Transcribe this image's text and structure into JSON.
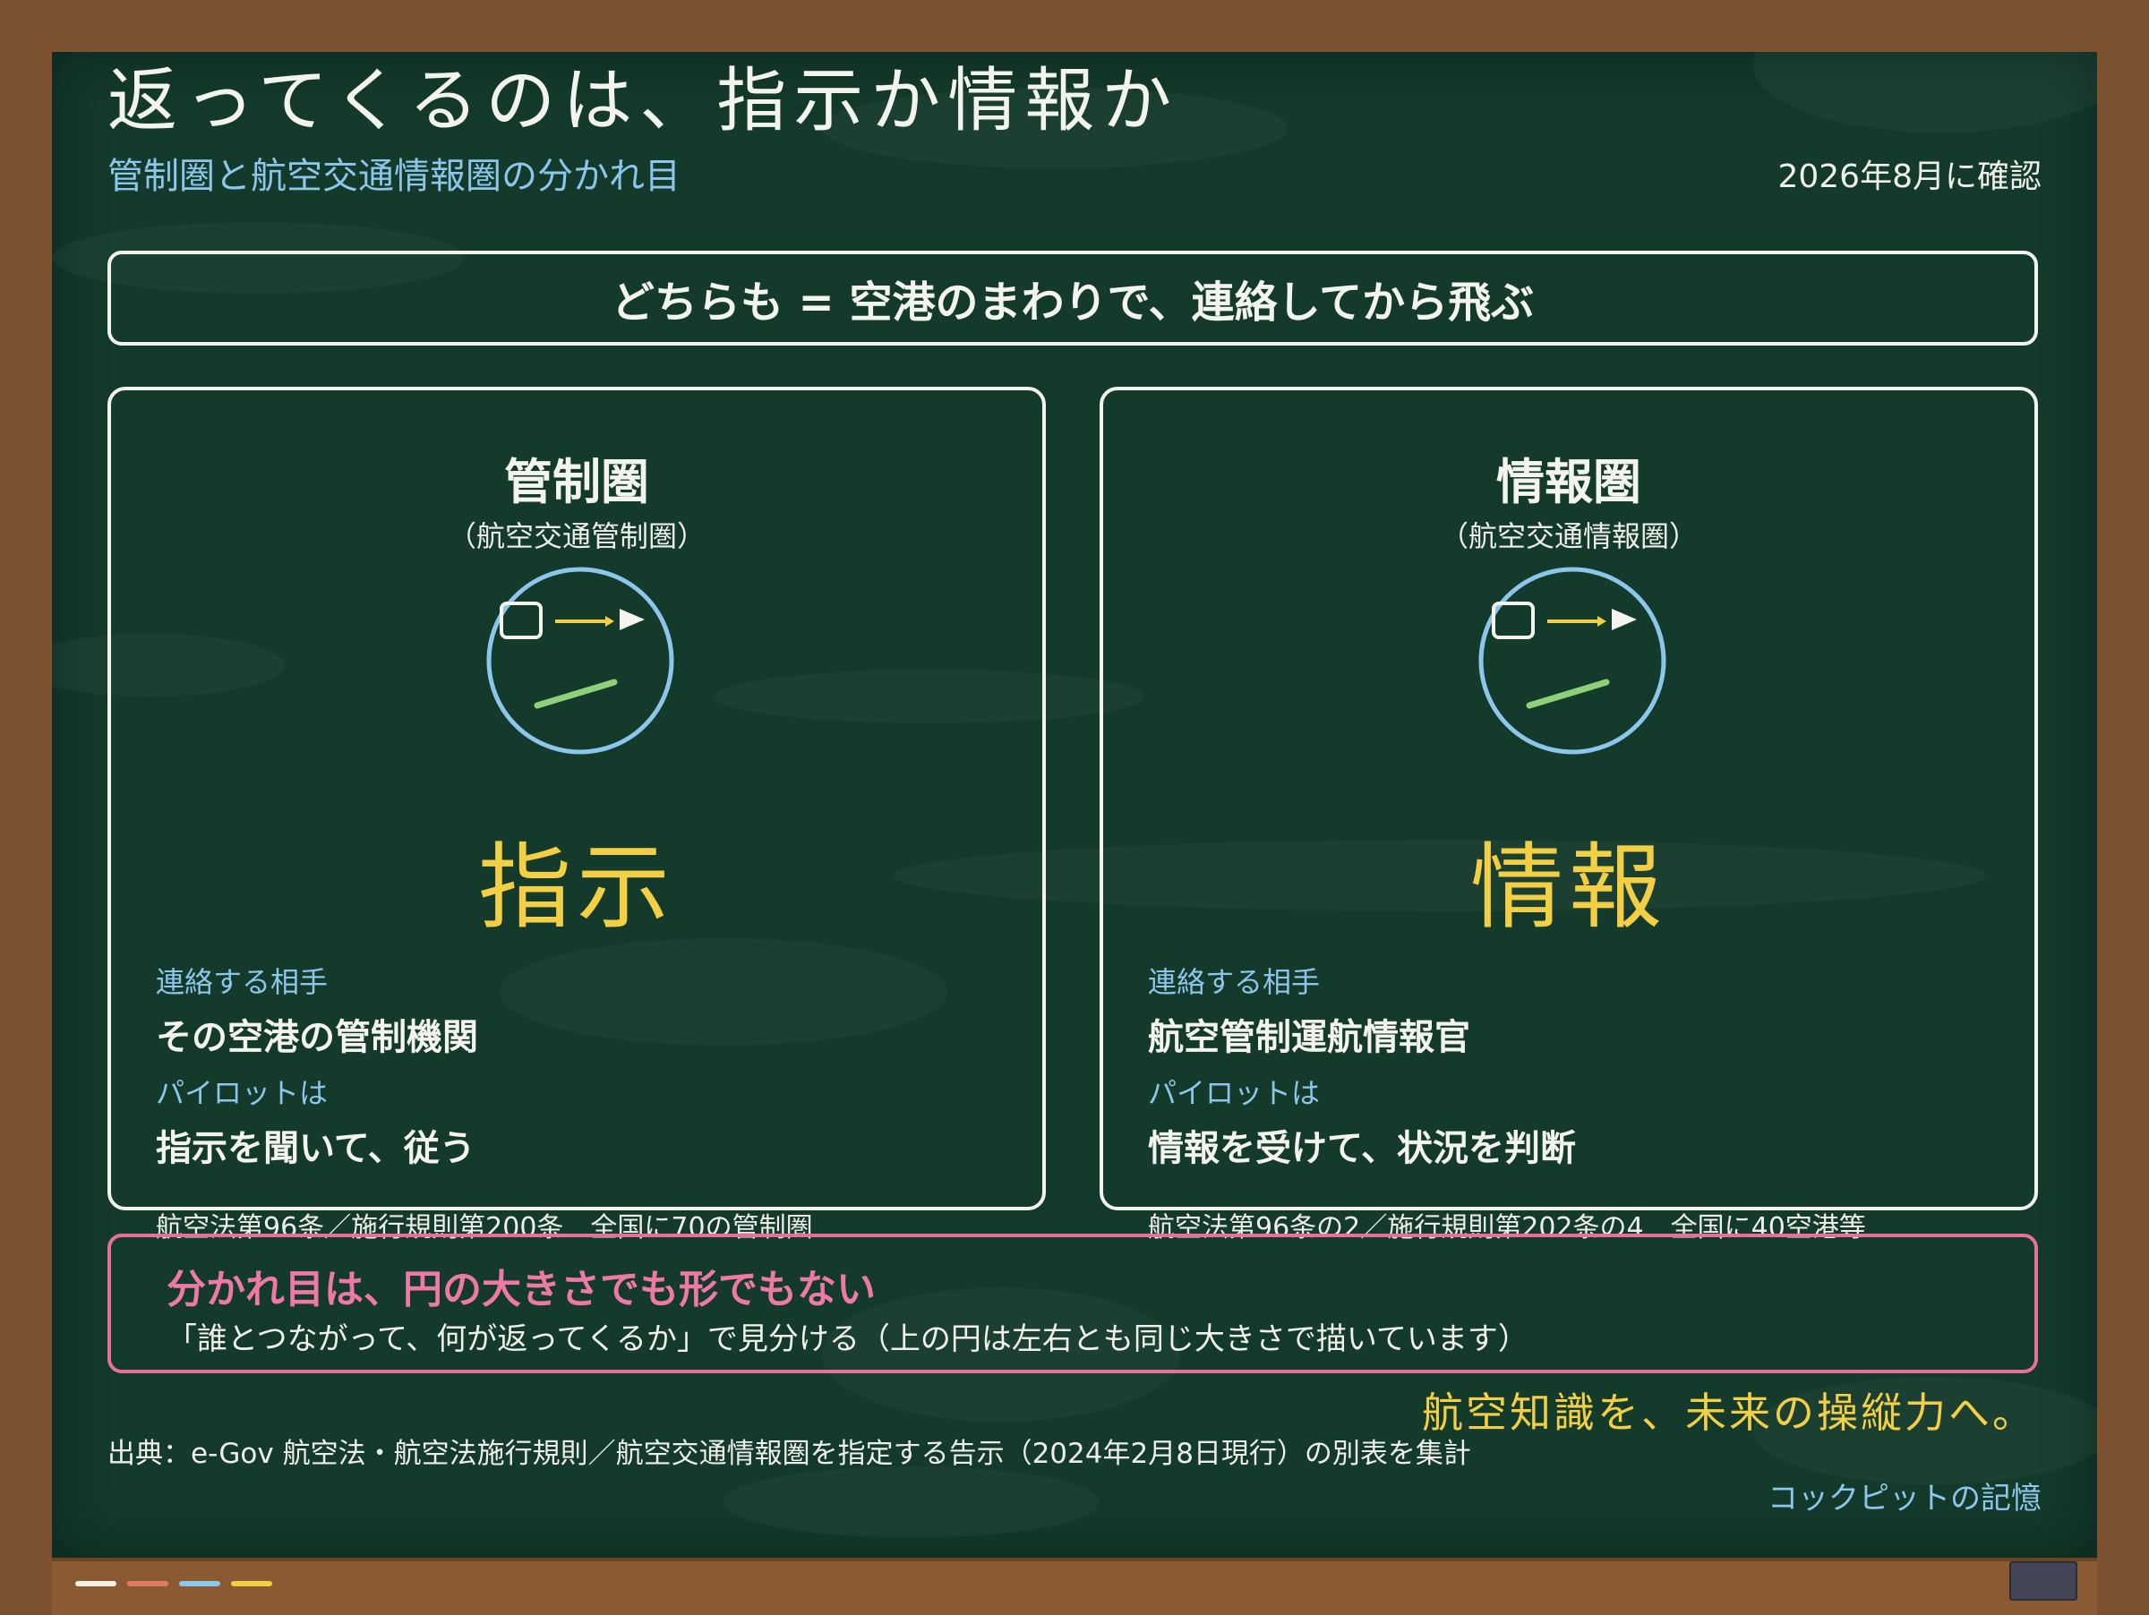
{
  "title": "返ってくるのは、指示か情報か",
  "subtitle": "管制圏と航空交通情報圏の分かれ目",
  "date_checked": "2026年8月に確認",
  "banner": "どちらも = 空港のまわりで、連絡してから飛ぶ",
  "panels": [
    {
      "title": "管制圏",
      "subtitle": "（航空交通管制圏）",
      "icon": "radio-circle-icon",
      "big_word": "指示",
      "contact_label": "連絡する相手",
      "contact_value": "その空港の管制機関",
      "pilot_label": "パイロットは",
      "pilot_value": "指示を聞いて、従う",
      "law": "航空法第96条／施行規則第200条　全国に70の管制圏"
    },
    {
      "title": "情報圏",
      "subtitle": "（航空交通情報圏）",
      "icon": "radio-circle-icon",
      "big_word": "情報",
      "contact_label": "連絡する相手",
      "contact_value": "航空管制運航情報官",
      "pilot_label": "パイロットは",
      "pilot_value": "情報を受けて、状況を判断",
      "law": "航空法第96条の2／施行規則第202条の4　全国に40空港等"
    }
  ],
  "note": {
    "heading": "分かれ目は、円の大きさでも形でもない",
    "body": "「誰とつながって、何が返ってくるか」で見分ける（上の円は左右とも同じ大きさで描いています）"
  },
  "slogan": "航空知識を、未来の操縦力へ。",
  "source": "出典：e-Gov 航空法・航空法施行規則／航空交通情報圏を指定する告示（2024年2月8日現行）の別表を集計",
  "brand": "コックピットの記憶",
  "colors": {
    "board": "#133a2a",
    "frame": "#7d5230",
    "chalk_white": "#f4f4ef",
    "chalk_blue": "#8cc6ea",
    "chalk_yellow": "#f2cf45",
    "chalk_pink": "#ee79a6",
    "chalk_green": "#8fd07a"
  },
  "tray_chalks": [
    "#f3f0e6",
    "#e07a6a",
    "#8cc6ea",
    "#f2cf45"
  ]
}
